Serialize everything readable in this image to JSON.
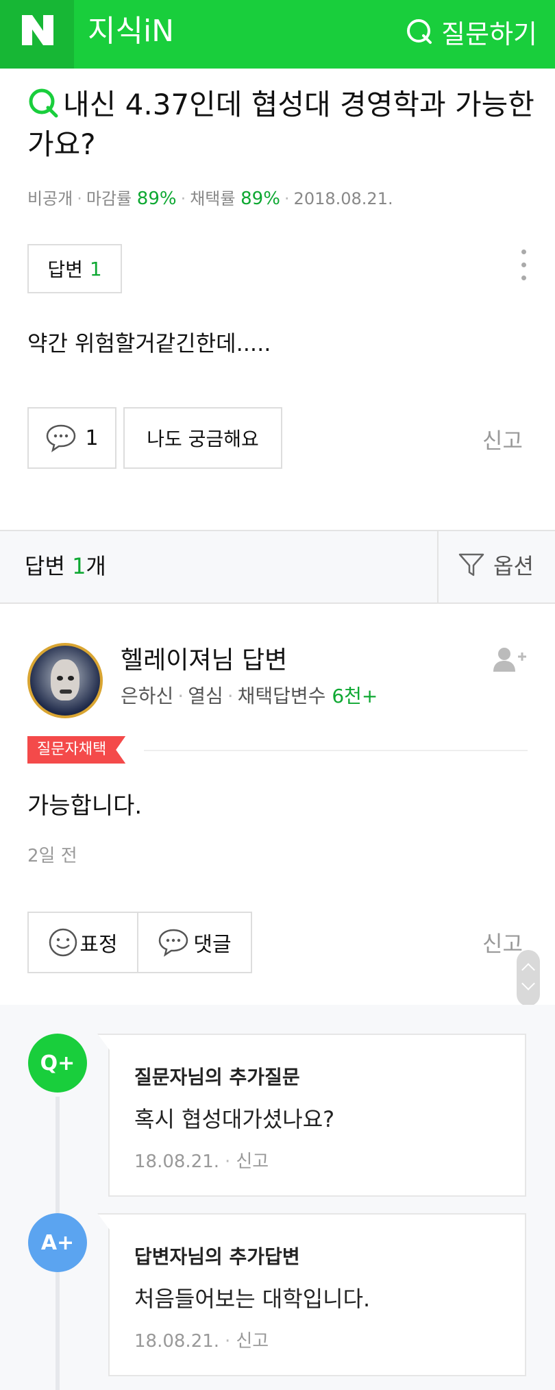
{
  "header": {
    "logo_letter": "N",
    "brand": "지식iN",
    "ask_label": "질문하기",
    "bg_color": "#19ce3c"
  },
  "question": {
    "title": "내신 4.37인데 협성대 경영학과 가능한가요?",
    "meta": {
      "visibility": "비공개",
      "close_rate_label": "마감률",
      "close_rate": "89%",
      "adopt_rate_label": "채택률",
      "adopt_rate": "89%",
      "date": "2018.08.21."
    },
    "answer_tag_label": "답변",
    "answer_tag_count": "1",
    "body": "약간 위험할거같긴한데.....",
    "comment_count": "1",
    "curious_label": "나도 궁금해요",
    "report_label": "신고"
  },
  "answers_bar": {
    "label_prefix": "답변 ",
    "count": "1",
    "label_suffix": "개",
    "options_label": "옵션"
  },
  "answer": {
    "name": "헬레이져님 답변",
    "grade": "은하신",
    "activity": "열심",
    "adopted_label": "채택답변수",
    "adopted_count": "6천+",
    "badge": "질문자채택",
    "body": "가능합니다.",
    "time": "2일 전",
    "emotion_label": "표정",
    "comment_label": "댓글",
    "report_label": "신고"
  },
  "followups": [
    {
      "circle_label": "Q+",
      "circle_color": "#19ce3c",
      "title": "질문자님의 추가질문",
      "body": "혹시 협성대가셨나요?",
      "date": "18.08.21.",
      "report": "신고"
    },
    {
      "circle_label": "A+",
      "circle_color": "#5ba4f0",
      "title": "답변자님의 추가답변",
      "body": "처음들어보는 대학입니다.",
      "date": "18.08.21.",
      "report": "신고"
    }
  ]
}
